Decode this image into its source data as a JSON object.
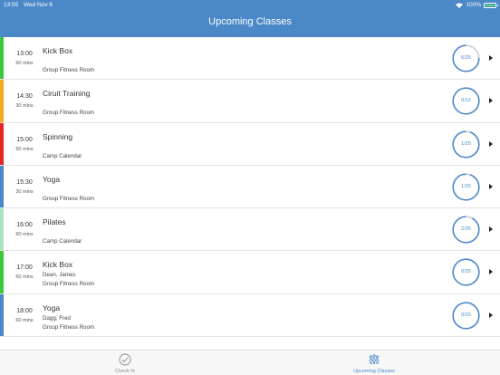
{
  "status_bar": {
    "time": "13:55",
    "date": "Wed Nov 6",
    "battery": "100%"
  },
  "header": {
    "title": "Upcoming Classes"
  },
  "classes": [
    {
      "time": "13:00",
      "duration": "60 mins",
      "name": "Kick Box",
      "instructor": "",
      "location": "Group Fitness Room",
      "count": "6/25",
      "booked": 6,
      "capacity": 25,
      "color": "#3cc83c"
    },
    {
      "time": "14:30",
      "duration": "30 mins",
      "name": "Ciruit Training",
      "instructor": "",
      "location": "Group Fitness Room",
      "count": "0/12",
      "booked": 0,
      "capacity": 12,
      "color": "#f5a623"
    },
    {
      "time": "15:00",
      "duration": "60 mins",
      "name": "Spinning",
      "instructor": "",
      "location": "Camp Calendar",
      "count": "1/20",
      "booked": 1,
      "capacity": 20,
      "color": "#e52525"
    },
    {
      "time": "15:30",
      "duration": "30 mins",
      "name": "Yoga",
      "instructor": "",
      "location": "Group Fitness Room",
      "count": "1/20",
      "booked": 1,
      "capacity": 20,
      "color": "#4a88c8"
    },
    {
      "time": "16:00",
      "duration": "60 mins",
      "name": "Pilates",
      "instructor": "",
      "location": "Camp Calendar",
      "count": "2/25",
      "booked": 2,
      "capacity": 25,
      "color": "#a8e6c0"
    },
    {
      "time": "17:00",
      "duration": "60 mins",
      "name": "Kick Box",
      "instructor": "Dean, James",
      "location": "Group Fitness Room",
      "count": "0/25",
      "booked": 0,
      "capacity": 25,
      "color": "#3cc83c"
    },
    {
      "time": "18:00",
      "duration": "60 mins",
      "name": "Yoga",
      "instructor": "Dagg, Fred",
      "location": "Group Fitness Room",
      "count": "0/20",
      "booked": 0,
      "capacity": 20,
      "color": "#4a88c8"
    }
  ],
  "tabs": {
    "check_in": {
      "label": "Check In",
      "icon": "checkmark-circle-icon"
    },
    "upcoming": {
      "label": "Upcoming Classes",
      "icon": "group-exercise-icon"
    }
  },
  "colors": {
    "header": "#4a88c8",
    "accent": "#4a88c8",
    "ring_track": "#d9d9d9"
  }
}
